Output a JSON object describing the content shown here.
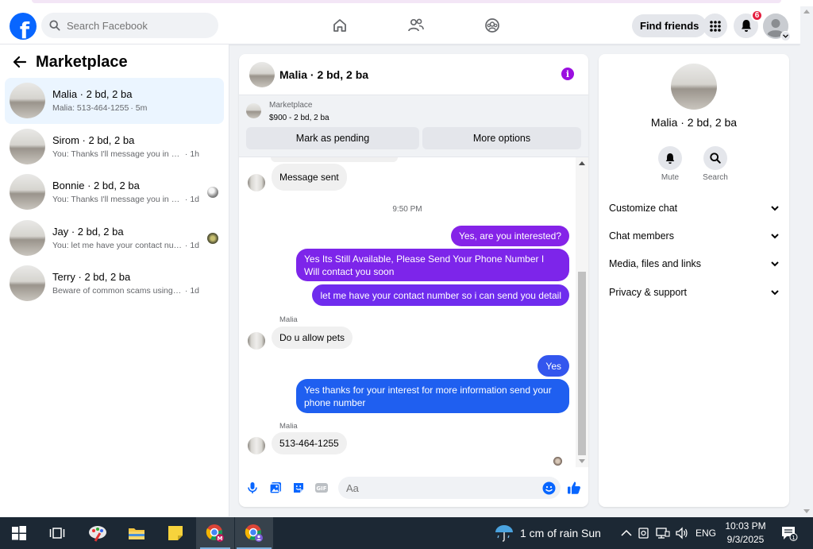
{
  "header": {
    "logo": "f",
    "search_placeholder": "Search Facebook",
    "find_friends": "Find friends",
    "notification_count": "6"
  },
  "sidebar": {
    "title": "Marketplace",
    "conversations": [
      {
        "title": "Malia · 2 bd, 2 ba",
        "message": "Malia: 513-464-1255",
        "time": "· 5m",
        "active": true
      },
      {
        "title": "Sirom · 2 bd, 2 ba",
        "message": "You: Thanks I'll message you in a mo...",
        "time": "· 1h"
      },
      {
        "title": "Bonnie · 2 bd, 2 ba",
        "message": "You: Thanks I'll message you in a m...",
        "time": "· 1d"
      },
      {
        "title": "Jay · 2 bd, 2 ba",
        "message": "You: let me have your contact num...",
        "time": "· 1d"
      },
      {
        "title": "Terry · 2 bd, 2 ba",
        "message": "Beware of common scams using pay...",
        "time": "· 1d"
      }
    ]
  },
  "chat": {
    "title": "Malia · 2 bd, 2 ba",
    "marketplace_label": "Marketplace",
    "listing": "$900 - 2 bd, 2 ba",
    "mark_pending": "Mark as pending",
    "more_options": "More options",
    "messages": {
      "m1": "Message sent",
      "time": "9:50 PM",
      "m2": "Yes, are you interested?",
      "m3": "Yes Its Still Available, Please Send Your Phone Number I Will contact you soon",
      "m4": "let me have your contact number so i can send you detail",
      "sender": "Malia",
      "m5": "Do u allow pets",
      "m6": "Yes",
      "m7": "Yes thanks for your interest for more information send your phone number",
      "m8": "513-464-1255"
    },
    "composer_placeholder": "Aa"
  },
  "right_panel": {
    "name": "Malia · 2 bd, 2 ba",
    "mute": "Mute",
    "search": "Search",
    "items": [
      "Customize chat",
      "Chat members",
      "Media, files and links",
      "Privacy & support"
    ]
  },
  "taskbar": {
    "weather": "1 cm of rain Sun",
    "lang": "ENG",
    "time": "10:03 PM",
    "date": "9/3/2025",
    "notif": "1"
  },
  "colors": {
    "fb_blue": "#0866ff",
    "purple_bubble": "#8a2be2",
    "blue_bubble": "#1f5ff0",
    "badge": "#e41e3f"
  }
}
